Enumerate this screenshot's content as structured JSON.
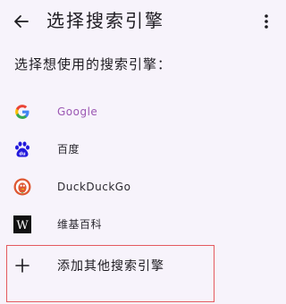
{
  "header": {
    "title": "选择搜索引擎",
    "back_icon": "arrow-left-icon",
    "menu_icon": "more-vert-icon"
  },
  "prompt": "选择想使用的搜索引擎：",
  "engines": [
    {
      "label": "Google",
      "icon": "google-icon",
      "selected": true
    },
    {
      "label": "百度",
      "icon": "baidu-icon",
      "selected": false
    },
    {
      "label": "DuckDuckGo",
      "icon": "duckduckgo-icon",
      "selected": false
    },
    {
      "label": "维基百科",
      "icon": "wikipedia-icon",
      "selected": false
    }
  ],
  "add_engine": {
    "label": "添加其他搜索引擎",
    "icon": "plus-icon"
  },
  "colors": {
    "background": "#f7f3fb",
    "selected_text": "#9b57b3",
    "highlight_border": "#e45a5f"
  }
}
